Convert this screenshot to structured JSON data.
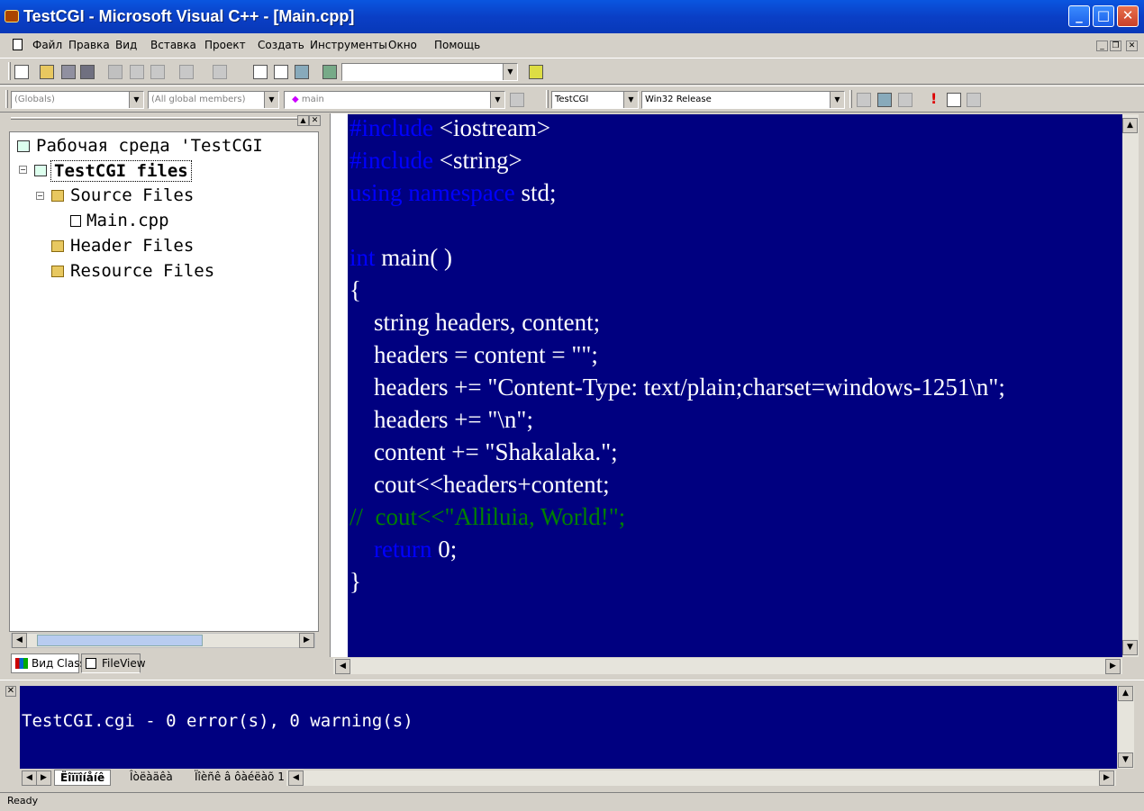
{
  "window": {
    "title": "TestCGI - Microsoft Visual C++ - [Main.cpp]"
  },
  "menu": {
    "items": [
      "Файл",
      "Правка",
      "Вид",
      "Вставка",
      "Проект",
      "Создать",
      "Инструменты",
      "Окно",
      "Помощь"
    ]
  },
  "toolbar": {
    "find_value": "",
    "wizard": {
      "scope": "(Globals)",
      "members": "(All global members)",
      "function": "main"
    },
    "build": {
      "project": "TestCGI",
      "configuration": "Win32 Release"
    }
  },
  "workspace": {
    "tree": {
      "root": "Рабочая среда 'TestCGI",
      "project": "TestCGI files",
      "source_folder": "Source Files",
      "file": "Main.cpp",
      "header_folder": "Header Files",
      "resource_folder": "Resource Files"
    },
    "tabs": [
      "Вид Class",
      "FileView"
    ]
  },
  "editor": {
    "lines": [
      [
        {
          "t": "#include",
          "k": "kw"
        },
        {
          "t": " <iostream>",
          "k": ""
        }
      ],
      [
        {
          "t": "#include",
          "k": "kw"
        },
        {
          "t": " <string>",
          "k": ""
        }
      ],
      [
        {
          "t": "using namespace",
          "k": "kw"
        },
        {
          "t": " std;",
          "k": ""
        }
      ],
      [],
      [
        {
          "t": "int",
          "k": "kw"
        },
        {
          "t": " main( )",
          "k": ""
        }
      ],
      [
        {
          "t": "{",
          "k": ""
        }
      ],
      [
        {
          "t": "    string headers, content;",
          "k": ""
        }
      ],
      [
        {
          "t": "    headers = content = \"\";",
          "k": ""
        }
      ],
      [
        {
          "t": "    headers += \"Content-Type: text/plain;charset=windows-1251\\n\";",
          "k": ""
        }
      ],
      [
        {
          "t": "    headers += \"\\n\";",
          "k": ""
        }
      ],
      [
        {
          "t": "    content += \"Shakalaka.\";",
          "k": ""
        }
      ],
      [
        {
          "t": "    cout<<headers+content;",
          "k": ""
        }
      ],
      [
        {
          "t": "//  cout<<\"Alliluia, World!\";",
          "k": "cm"
        }
      ],
      [
        {
          "t": "    ",
          "k": ""
        },
        {
          "t": "return",
          "k": "kw"
        },
        {
          "t": " 0;",
          "k": ""
        }
      ],
      [
        {
          "t": "}",
          "k": ""
        }
      ]
    ]
  },
  "output": {
    "text": "TestCGI.cgi - 0 error(s), 0 warning(s)",
    "tabs": [
      "Ëîïïîíåíê",
      "Îòëàäêà",
      "Ïîèñê â ôàéëàõ 1"
    ]
  },
  "status": {
    "text": "Ready"
  }
}
